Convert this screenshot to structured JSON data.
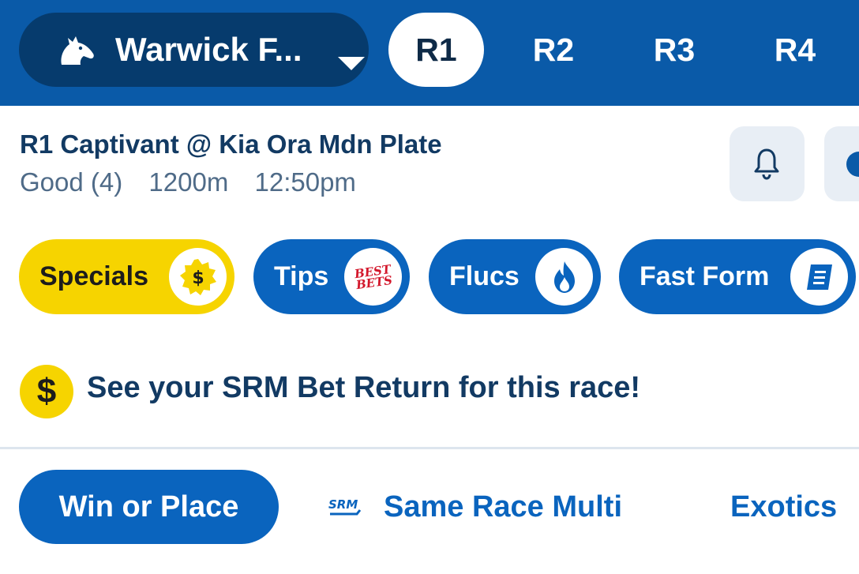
{
  "header": {
    "venue": "Warwick F...",
    "race_tabs": [
      "R1",
      "R2",
      "R3",
      "R4"
    ],
    "active_tab": "R1"
  },
  "race": {
    "title": "R1 Captivant @ Kia Ora Mdn Plate",
    "track": "Good (4)",
    "distance": "1200m",
    "time": "12:50pm"
  },
  "chips": [
    {
      "label": "Specials",
      "icon": "dollar-badge-icon",
      "style": "yellow"
    },
    {
      "label": "Tips",
      "icon": "best-bets-icon",
      "icon_text": "BEST BETS",
      "style": "blue"
    },
    {
      "label": "Flucs",
      "icon": "flame-icon",
      "style": "blue"
    },
    {
      "label": "Fast Form",
      "icon": "form-sheet-icon",
      "style": "blue"
    }
  ],
  "promo": {
    "icon": "dollar-return-icon",
    "icon_text": "$",
    "text": "See your SRM Bet Return for this race!"
  },
  "bet_tabs": {
    "win_place": "Win or Place",
    "srm_logo": "SRM",
    "same_race_multi": "Same Race Multi",
    "exotics": "Exotics"
  },
  "colors": {
    "header_blue": "#0a5aa8",
    "venue_pill": "#063b6d",
    "accent_blue": "#0a64be",
    "yellow": "#f6d400",
    "text_navy": "#123a63"
  }
}
